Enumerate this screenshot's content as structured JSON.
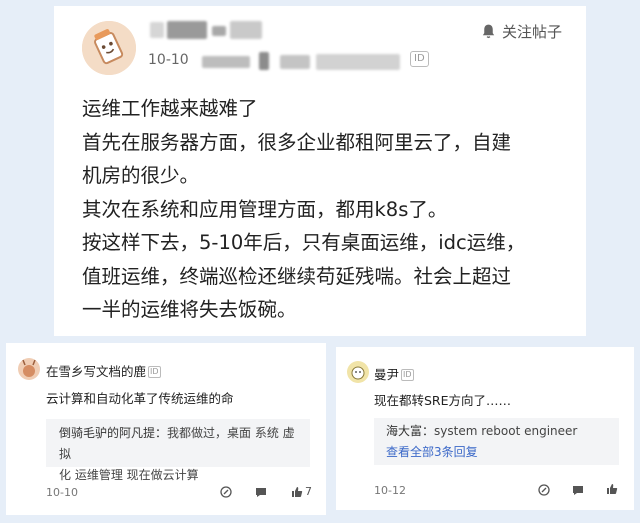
{
  "post": {
    "follow_label": "关注帖子",
    "date": "10-10",
    "id_badge": "ID",
    "lines": [
      "运维工作越来越难了",
      "首先在服务器方面，很多企业都租阿里云了，自建",
      "机房的很少。",
      "其次在系统和应用管理方面，都用k8s了。",
      "按这样下去，5-10年后，只有桌面运维，idc运维，",
      "值班运维，终端巡检还继续苟延残喘。社会上超过",
      "一半的运维将失去饭碗。"
    ]
  },
  "comments": [
    {
      "author": "在雪乡写文档的鹿",
      "id_badge": "ID",
      "text": "云计算和自动化革了传统运维的命",
      "reply_author": "倒骑毛驴的阿凡提：",
      "reply_line1": "我都做过，桌面 系统 虚拟",
      "reply_line2": "化 运维管理 现在做云计算",
      "date": "10-10",
      "like_count": "7"
    },
    {
      "author": "曼尹",
      "id_badge": "ID",
      "text": "现在都转SRE方向了……",
      "reply_author": "海大富：",
      "reply_text": "system reboot engineer",
      "view_all": "查看全部3条回复",
      "date": "10-12"
    }
  ],
  "icons": {
    "follow": "bell-icon",
    "edit": "edit-icon",
    "comment": "comment-icon",
    "like": "thumbs-up-icon"
  }
}
